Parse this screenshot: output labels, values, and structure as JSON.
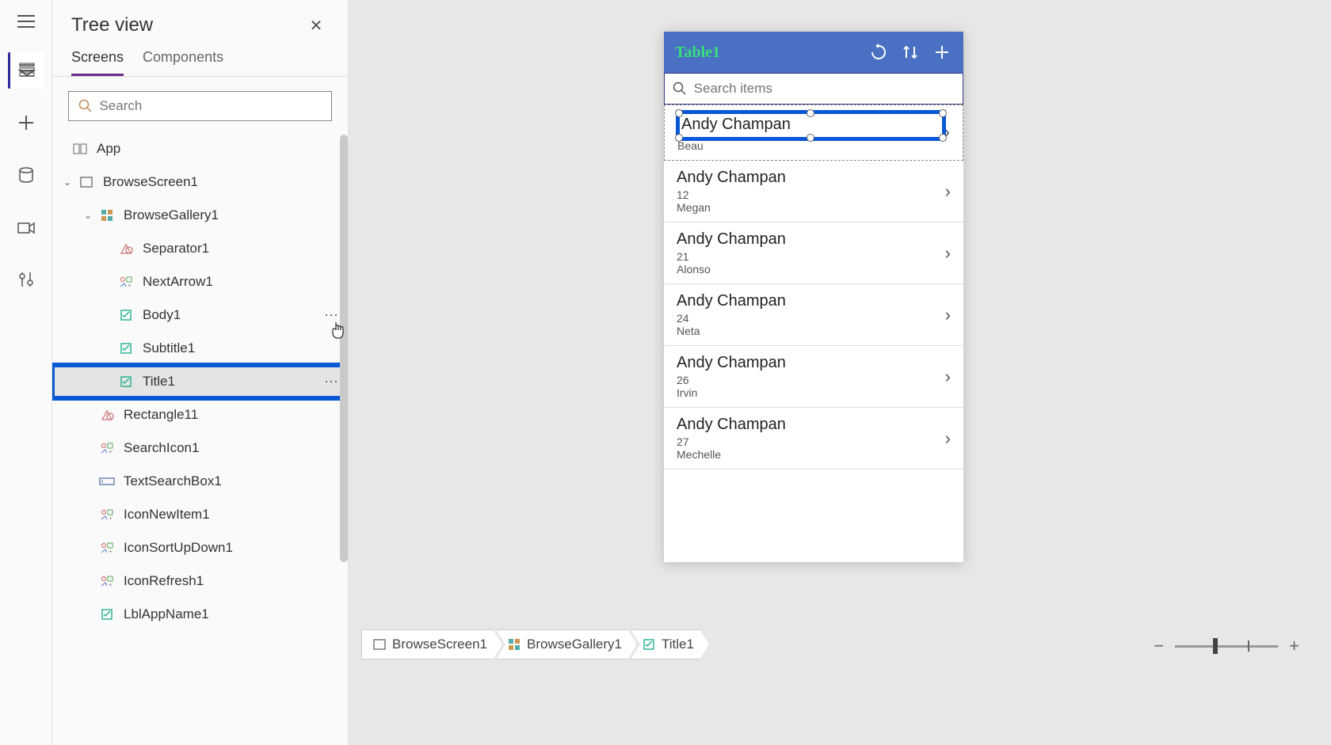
{
  "panel": {
    "title": "Tree view",
    "tabs": [
      "Screens",
      "Components"
    ],
    "active_tab": 0,
    "search_placeholder": "Search"
  },
  "tree": {
    "app": "App",
    "screen": "BrowseScreen1",
    "gallery": "BrowseGallery1",
    "items": [
      {
        "name": "Separator1",
        "icon": "shape"
      },
      {
        "name": "NextArrow1",
        "icon": "iconctrl"
      },
      {
        "name": "Body1",
        "icon": "label",
        "hover": true
      },
      {
        "name": "Subtitle1",
        "icon": "label"
      },
      {
        "name": "Title1",
        "icon": "label",
        "selected": true,
        "highlight": true
      }
    ],
    "rest": [
      {
        "name": "Rectangle11",
        "icon": "shape"
      },
      {
        "name": "SearchIcon1",
        "icon": "iconctrl"
      },
      {
        "name": "TextSearchBox1",
        "icon": "textinput"
      },
      {
        "name": "IconNewItem1",
        "icon": "iconctrl"
      },
      {
        "name": "IconSortUpDown1",
        "icon": "iconctrl"
      },
      {
        "name": "IconRefresh1",
        "icon": "iconctrl"
      },
      {
        "name": "LblAppName1",
        "icon": "label"
      }
    ]
  },
  "app": {
    "title": "Table1",
    "search_placeholder": "Search items",
    "rows": [
      {
        "title": "Andy Champan",
        "sub": "",
        "body": "Beau",
        "selected": true
      },
      {
        "title": "Andy Champan",
        "sub": "12",
        "body": "Megan"
      },
      {
        "title": "Andy Champan",
        "sub": "21",
        "body": "Alonso"
      },
      {
        "title": "Andy Champan",
        "sub": "24",
        "body": "Neta"
      },
      {
        "title": "Andy Champan",
        "sub": "26",
        "body": "Irvin"
      },
      {
        "title": "Andy Champan",
        "sub": "27",
        "body": "Mechelle"
      }
    ]
  },
  "breadcrumb": [
    "BrowseScreen1",
    "BrowseGallery1",
    "Title1"
  ],
  "zoom": {
    "minus": "−",
    "plus": "+"
  }
}
